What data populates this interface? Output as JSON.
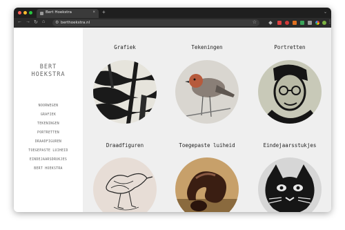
{
  "browser": {
    "tab_title": "Bert Hoekstra",
    "tab_close": "×",
    "new_tab": "+",
    "tab_menu": "⌄",
    "url": "berthoekstra.nl",
    "traffic_lights": [
      "#ff5f57",
      "#febc2e",
      "#28c840"
    ],
    "nav": {
      "back": "←",
      "forward": "→",
      "reload": "↻",
      "home": "⌂"
    },
    "omni_icon": "⚙",
    "star": "☆",
    "extensions": [
      {
        "name": "pen-icon",
        "color": "#cccccc"
      },
      {
        "name": "ext-red-icon",
        "color": "#e04040"
      },
      {
        "name": "ext-red2-icon",
        "color": "#d23a3a"
      },
      {
        "name": "ext-orange-icon",
        "color": "#e07020"
      },
      {
        "name": "ext-green-icon",
        "color": "#3aa55a"
      },
      {
        "name": "puzzle-icon",
        "color": "#cccccc"
      },
      {
        "name": "ext-multicolor-icon",
        "color": "#f4b400"
      },
      {
        "name": "avatar",
        "color": "#7cb342"
      },
      {
        "name": "menu-icon",
        "color": "#cccccc"
      }
    ]
  },
  "site": {
    "title_line1": "BERT",
    "title_line2": "HOEKSTRA",
    "menu": [
      "NOORWEGEN",
      "GRAFIEK",
      "TEKENINGEN",
      "PORTRETTEN",
      "DRAADFIGUREN",
      "TOEGEPASTE LUIHEID",
      "EINDEJAARSDRUKJES",
      "BERT HOEKSTRA"
    ]
  },
  "gallery": [
    {
      "title": "Grafiek",
      "image": "woodcut-print-image"
    },
    {
      "title": "Tekeningen",
      "image": "bird-drawing-image"
    },
    {
      "title": "Portretten",
      "image": "portrait-print-image"
    },
    {
      "title": "Draadfiguren",
      "image": "wire-bird-image"
    },
    {
      "title": "Toegepaste luiheid",
      "image": "ceramic-object-image"
    },
    {
      "title": "Eindejaarsstukjes",
      "image": "cat-print-image"
    }
  ],
  "colors": {
    "sidebar_bg": "#ffffff",
    "main_bg": "#efefef",
    "text": "#222222",
    "menu_text": "#666666"
  }
}
